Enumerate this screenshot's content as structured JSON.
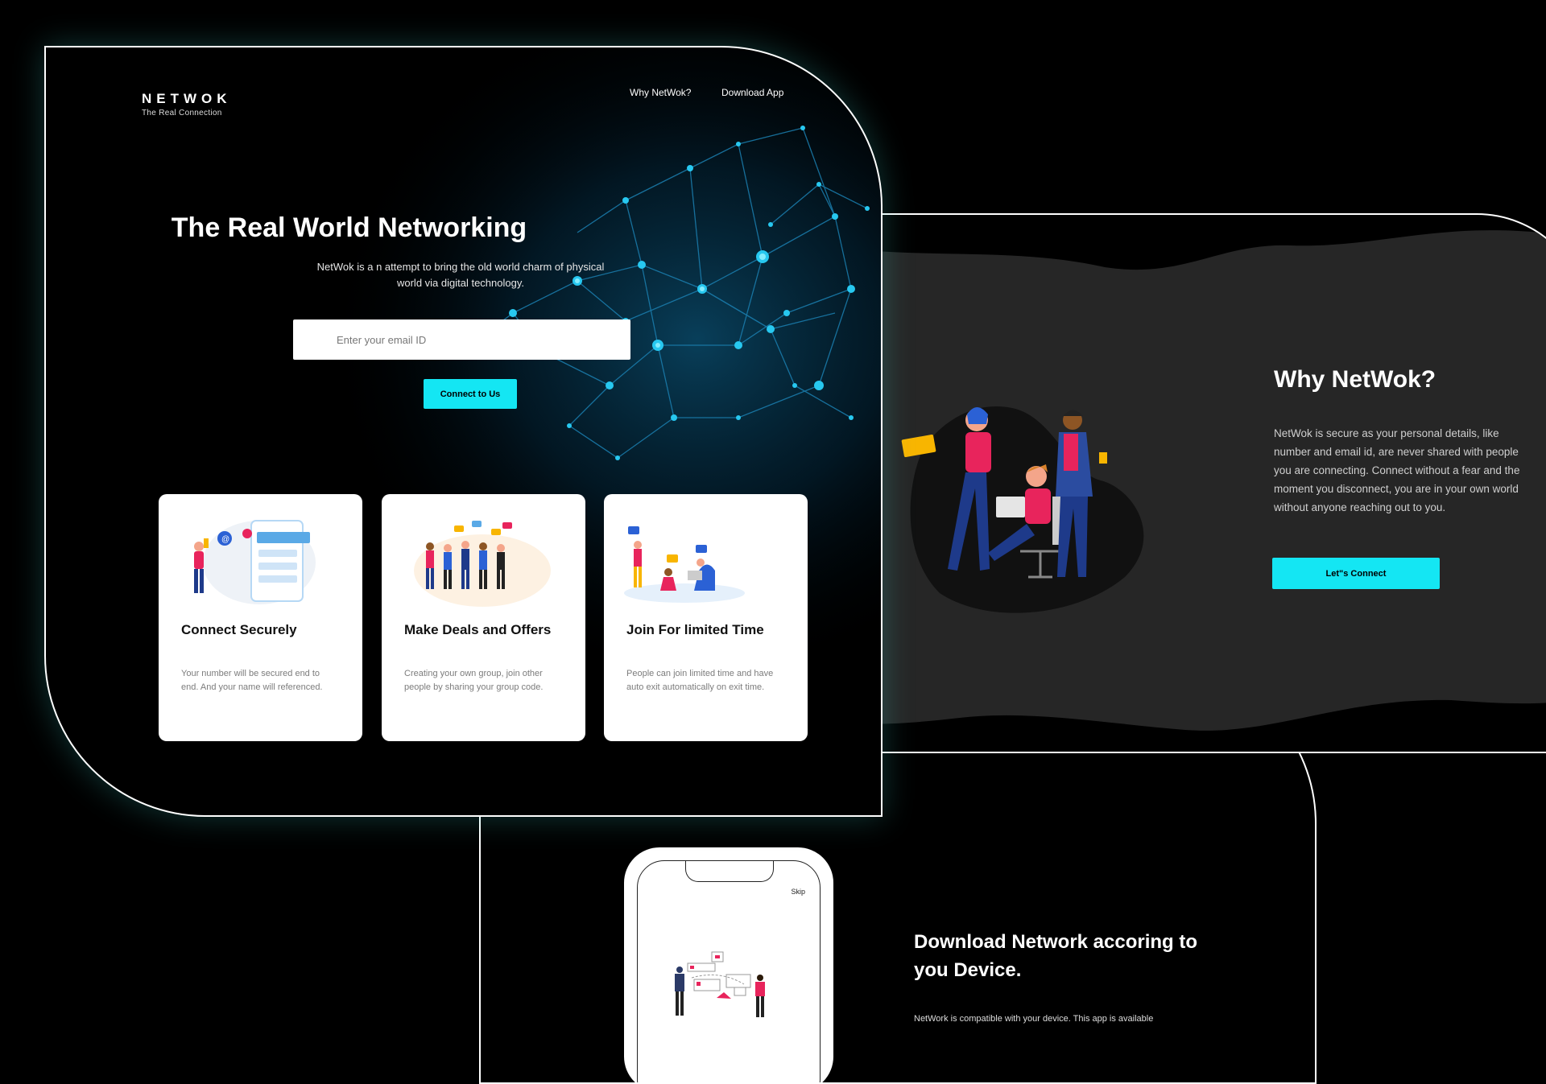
{
  "brand": {
    "name": "NETWOK",
    "tagline": "The Real Connection"
  },
  "nav": {
    "why": "Why NetWok?",
    "download": "Download App"
  },
  "hero": {
    "title": "The Real World Networking",
    "description": "NetWok is a n attempt to bring the old world charm of physical world via digital technology.",
    "email_placeholder": "Enter your email ID",
    "cta_label": "Connect to Us"
  },
  "cards": [
    {
      "title": "Connect Securely",
      "text": "Your number will be secured end to end. And your name will referenced."
    },
    {
      "title": "Make Deals and Offers",
      "text": "Creating your own group, join other people by sharing your group code."
    },
    {
      "title": "Join For limited Time",
      "text": "People can join limited time and have auto exit automatically on exit time."
    }
  ],
  "why": {
    "title": "Why NetWok?",
    "text": "NetWok is secure as your personal details, like number and email id, are never shared with people you are connecting. Connect without a fear and the moment you disconnect, you are in your own world without anyone reaching out to you.",
    "button_label": "Let\"s Connect"
  },
  "download": {
    "title": "Download Network accoring to you Device.",
    "text": "NetWork is compatible with your device. This app is available",
    "skip_label": "Skip"
  },
  "colors": {
    "accent": "#14e6f3",
    "panel": "#262626",
    "background": "#000000"
  }
}
